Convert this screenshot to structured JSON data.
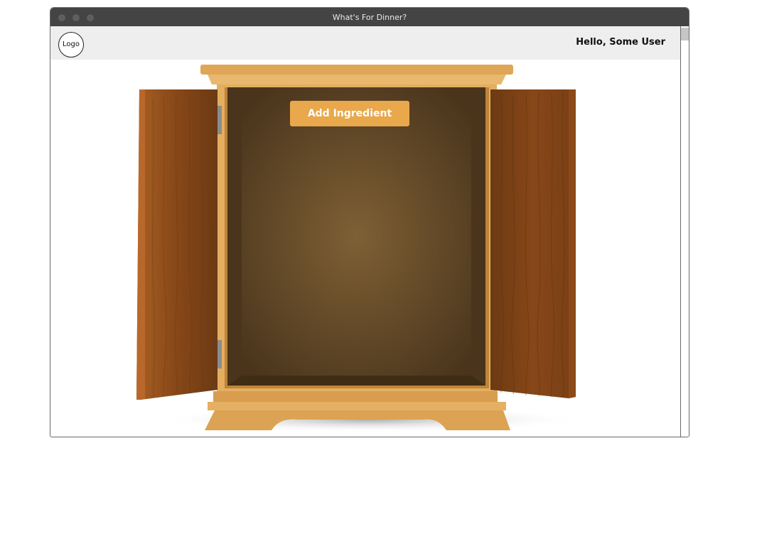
{
  "window": {
    "title": "What's For Dinner?"
  },
  "header": {
    "logo_text": "Logo",
    "greeting": "Hello, Some User"
  },
  "main": {
    "add_button_label": "Add Ingredient"
  },
  "icons": {
    "cabinet": "open-wooden-cabinet-illustration"
  },
  "colors": {
    "titlebar": "#444444",
    "appbar": "#eeeeee",
    "accent": "#e9a84c",
    "wood_light": "#dea655",
    "wood_dark": "#7a4415",
    "interior": "#5a4224"
  }
}
